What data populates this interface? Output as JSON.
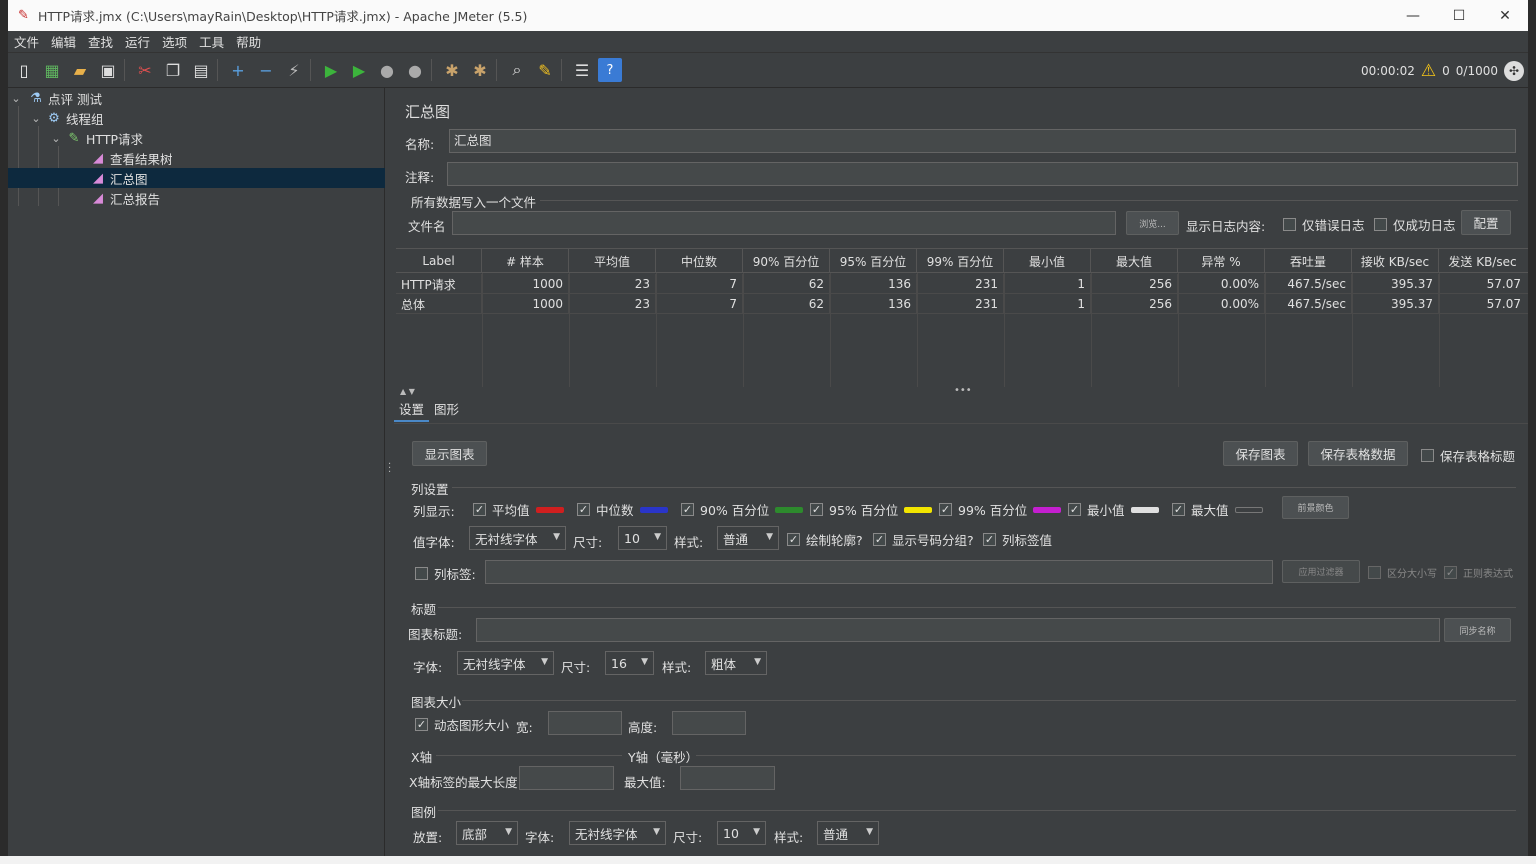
{
  "window": {
    "title": "HTTP请求.jmx (C:\\Users\\mayRain\\Desktop\\HTTP请求.jmx) - Apache JMeter (5.5)",
    "minimize": "—",
    "maximize": "☐",
    "close": "✕"
  },
  "menu": [
    "文件",
    "编辑",
    "查找",
    "运行",
    "选项",
    "工具",
    "帮助"
  ],
  "toolbar": {
    "elapsed": "00:00:02",
    "warnings": "0",
    "threads": "0/1000"
  },
  "tree": {
    "items": [
      {
        "label": "点评 测试",
        "icon": "flask-icon"
      },
      {
        "label": "线程组",
        "icon": "gear-icon"
      },
      {
        "label": "HTTP请求",
        "icon": "pipette-icon"
      },
      {
        "label": "查看结果树",
        "icon": "chart-icon"
      },
      {
        "label": "汇总图",
        "icon": "chart-icon"
      },
      {
        "label": "汇总报告",
        "icon": "chart-icon"
      }
    ]
  },
  "panel": {
    "title": "汇总图",
    "name_label": "名称:",
    "name_value": "汇总图",
    "comment_label": "注释:",
    "comment_value": "",
    "file_group": "所有数据写入一个文件",
    "filename_label": "文件名",
    "browse": "浏览...",
    "log_content_label": "显示日志内容:",
    "errors_only": "仅错误日志",
    "success_only": "仅成功日志",
    "configure": "配置"
  },
  "table": {
    "headers": [
      "Label",
      "# 样本",
      "平均值",
      "中位数",
      "90% 百分位",
      "95% 百分位",
      "99% 百分位",
      "最小值",
      "最大值",
      "异常 %",
      "吞吐量",
      "接收 KB/sec",
      "发送 KB/sec"
    ],
    "rows": [
      [
        "HTTP请求",
        "1000",
        "23",
        "7",
        "62",
        "136",
        "231",
        "1",
        "256",
        "0.00%",
        "467.5/sec",
        "395.37",
        "57.07"
      ],
      [
        "总体",
        "1000",
        "23",
        "7",
        "62",
        "136",
        "231",
        "1",
        "256",
        "0.00%",
        "467.5/sec",
        "395.37",
        "57.07"
      ]
    ]
  },
  "tabs": [
    "设置",
    "图形"
  ],
  "settings": {
    "display_graph": "显示图表",
    "save_graph": "保存图表",
    "save_table": "保存表格数据",
    "save_table_header": "保存表格标题",
    "column_settings": "列设置",
    "columns_display": "列显示:",
    "columns": [
      {
        "label": "平均值",
        "color": "#d01f1f"
      },
      {
        "label": "中位数",
        "color": "#2a35c9"
      },
      {
        "label": "90% 百分位",
        "color": "#2d8a2d"
      },
      {
        "label": "95% 百分位",
        "color": "#f2e500"
      },
      {
        "label": "99% 百分位",
        "color": "#c41fd0"
      },
      {
        "label": "最小值",
        "color": "#e0e0e0"
      },
      {
        "label": "最大值",
        "color": "#3c3f41"
      }
    ],
    "fg_color": "前景颜色",
    "value_font_label": "值字体:",
    "value_font": "无衬线字体",
    "size_label": "尺寸:",
    "value_size": "10",
    "style_label": "样式:",
    "value_style": "普通",
    "draw_outline": "绘制轮廓?",
    "show_grouping": "显示号码分组?",
    "column_label_values": "列标签值",
    "column_label": "列标签:",
    "apply_filter": "应用过滤器",
    "case_sensitive": "区分大小写",
    "regex": "正则表达式",
    "title_group": "标题",
    "chart_title_label": "图表标题:",
    "sync_name": "同步名称",
    "font_label": "字体:",
    "title_font": "无衬线字体",
    "title_size": "16",
    "title_style": "粗体",
    "size_group": "图表大小",
    "dynamic_size": "动态图形大小",
    "width_label": "宽:",
    "height_label": "高度:",
    "x_axis": "X轴",
    "y_axis": "Y轴（毫秒）",
    "x_max_label": "X轴标签的最大长度",
    "max_value_label": "最大值:",
    "legend_group": "图例",
    "placement_label": "放置:",
    "legend_placement": "底部",
    "legend_font": "无衬线字体",
    "legend_size": "10",
    "legend_style": "普通"
  }
}
